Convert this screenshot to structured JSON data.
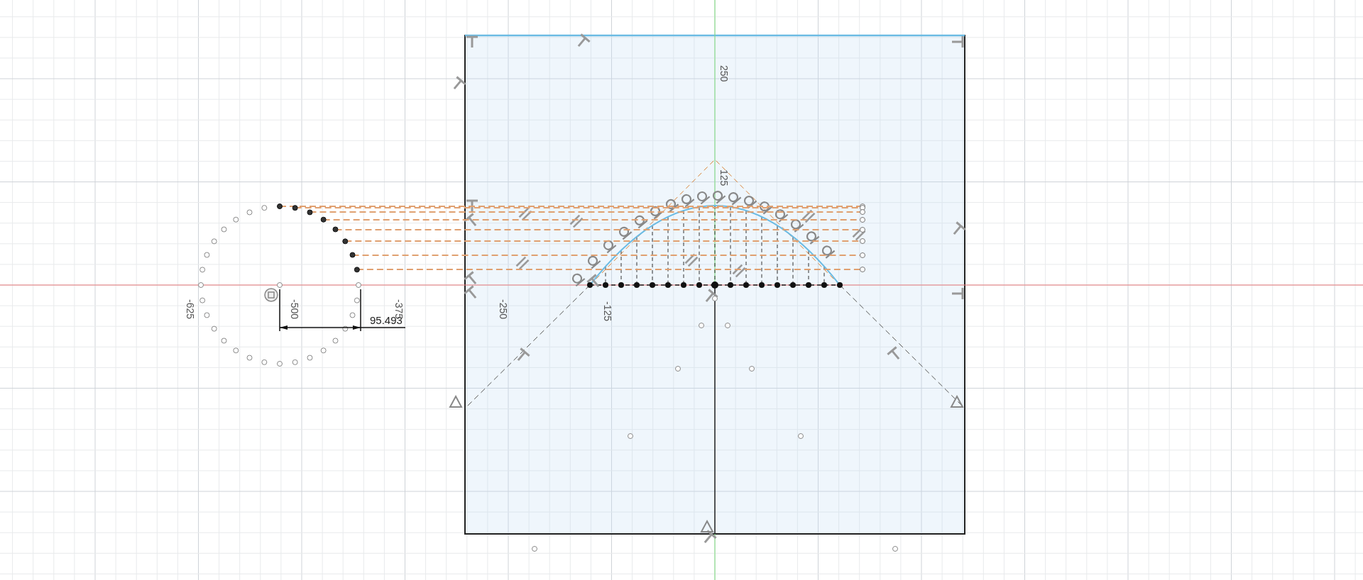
{
  "sketch": {
    "axis_labels": [
      "-625",
      "-500",
      "-375",
      "-250",
      "-125",
      "125",
      "250"
    ],
    "dimension": {
      "value": "95.493"
    }
  }
}
